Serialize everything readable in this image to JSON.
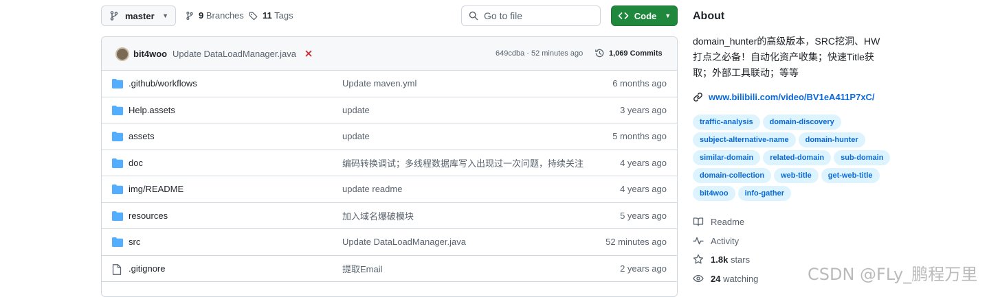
{
  "toolbar": {
    "branch": "master",
    "branches_count": "9",
    "branches_label": "Branches",
    "tags_count": "11",
    "tags_label": "Tags",
    "search_placeholder": "Go to file",
    "code_label": "Code"
  },
  "latest_commit": {
    "author": "bit4woo",
    "message": "Update DataLoadManager.java",
    "status": "failed",
    "sha_time": "649cdba · 52 minutes ago",
    "commits_label": "1,069 Commits"
  },
  "files": [
    {
      "name": ".github/workflows",
      "type": "folder",
      "message": "Update maven.yml",
      "age": "6 months ago"
    },
    {
      "name": "Help.assets",
      "type": "folder",
      "message": "update",
      "age": "3 years ago"
    },
    {
      "name": "assets",
      "type": "folder",
      "message": "update",
      "age": "5 months ago"
    },
    {
      "name": "doc",
      "type": "folder",
      "message": "编码转换调试；多线程数据库写入出现过一次问题，持续关注",
      "age": "4 years ago"
    },
    {
      "name": "img/README",
      "type": "folder",
      "message": "update readme",
      "age": "4 years ago"
    },
    {
      "name": "resources",
      "type": "folder",
      "message": "加入域名爆破模块",
      "age": "5 years ago"
    },
    {
      "name": "src",
      "type": "folder",
      "message": "Update DataLoadManager.java",
      "age": "52 minutes ago"
    },
    {
      "name": ".gitignore",
      "type": "file",
      "message": "提取Email",
      "age": "2 years ago"
    }
  ],
  "about": {
    "title": "About",
    "description": "domain_hunter的高级版本，SRC挖洞、HW打点之必备！自动化资产收集；快速Title获取；外部工具联动；等等",
    "url": "www.bilibili.com/video/BV1eA411P7xC/",
    "topics": [
      "traffic-analysis",
      "domain-discovery",
      "subject-alternative-name",
      "domain-hunter",
      "similar-domain",
      "related-domain",
      "sub-domain",
      "domain-collection",
      "web-title",
      "get-web-title",
      "bit4woo",
      "info-gather"
    ],
    "readme_label": "Readme",
    "activity_label": "Activity",
    "stars_count": "1.8k",
    "stars_label": "stars",
    "watching_count": "24",
    "watching_label": "watching"
  },
  "watermark": "CSDN @FLy_鹏程万里",
  "colors": {
    "accent_green": "#1f883d",
    "link_blue": "#0969da",
    "folder_blue": "#54aeff",
    "fail_red": "#d1242f"
  }
}
